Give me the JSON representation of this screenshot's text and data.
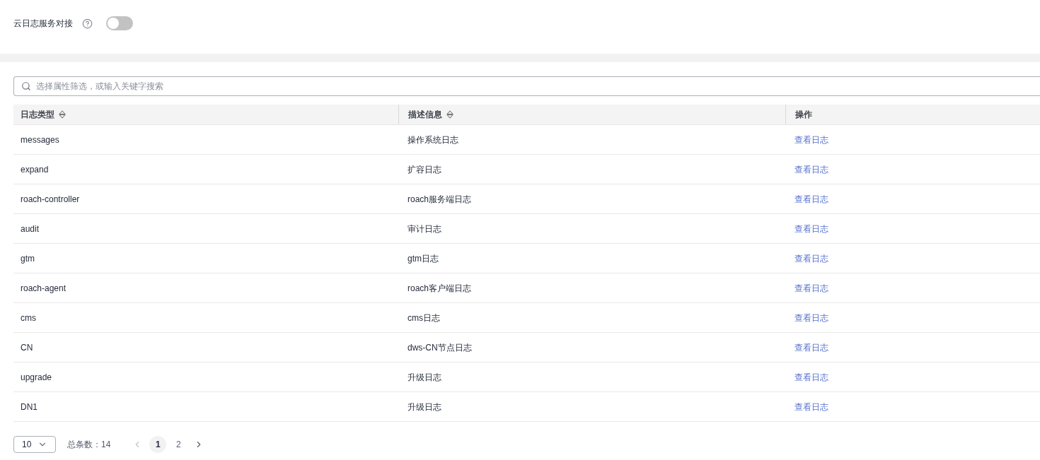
{
  "header": {
    "label": "云日志服务对接",
    "toggle": {
      "on": false
    }
  },
  "search": {
    "placeholder": "选择属性筛选，或输入关键字搜索"
  },
  "table": {
    "columns": [
      {
        "label": "日志类型",
        "sortable": true
      },
      {
        "label": "描述信息",
        "sortable": true
      },
      {
        "label": "操作",
        "sortable": false
      }
    ],
    "rows": [
      {
        "type": "messages",
        "description": "操作系统日志",
        "action": "查看日志"
      },
      {
        "type": "expand",
        "description": "扩容日志",
        "action": "查看日志"
      },
      {
        "type": "roach-controller",
        "description": "roach服务端日志",
        "action": "查看日志"
      },
      {
        "type": "audit",
        "description": "审计日志",
        "action": "查看日志"
      },
      {
        "type": "gtm",
        "description": "gtm日志",
        "action": "查看日志"
      },
      {
        "type": "roach-agent",
        "description": "roach客户端日志",
        "action": "查看日志"
      },
      {
        "type": "cms",
        "description": "cms日志",
        "action": "查看日志"
      },
      {
        "type": "CN",
        "description": "dws-CN节点日志",
        "action": "查看日志"
      },
      {
        "type": "upgrade",
        "description": "升级日志",
        "action": "查看日志"
      },
      {
        "type": "DN1",
        "description": "升级日志",
        "action": "查看日志"
      }
    ]
  },
  "pagination": {
    "page_size": "10",
    "total_label": "总条数：14",
    "prev": {
      "disabled": true
    },
    "next": {
      "disabled": false
    },
    "pages": [
      {
        "label": "1",
        "selected": true
      },
      {
        "label": "2",
        "selected": false
      }
    ]
  }
}
